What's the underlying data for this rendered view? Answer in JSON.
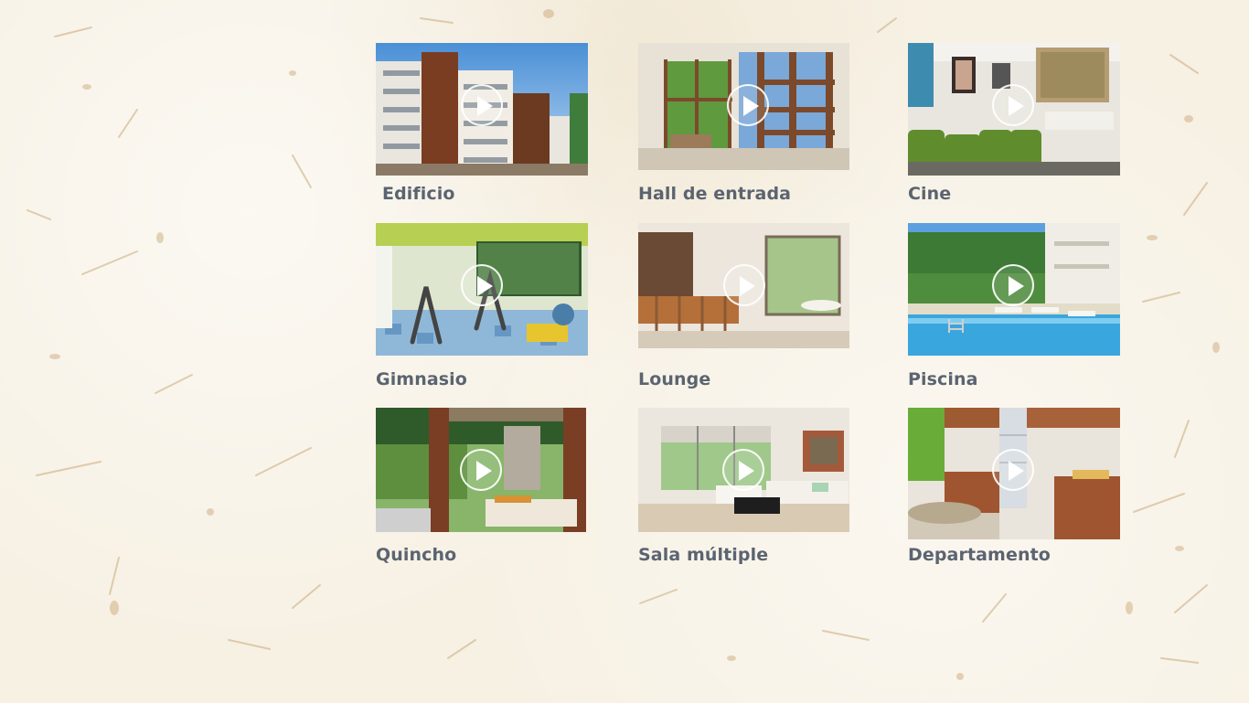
{
  "gallery": {
    "items": [
      {
        "label": "Edificio",
        "icon": "play-icon"
      },
      {
        "label": "Hall de entrada",
        "icon": "play-icon"
      },
      {
        "label": "Cine",
        "icon": "play-icon"
      },
      {
        "label": "Gimnasio",
        "icon": "play-icon"
      },
      {
        "label": "Lounge",
        "icon": "play-icon"
      },
      {
        "label": "Piscina",
        "icon": "play-icon"
      },
      {
        "label": "Quincho",
        "icon": "play-icon"
      },
      {
        "label": "Sala múltiple",
        "icon": "play-icon"
      },
      {
        "label": "Departamento",
        "icon": "play-icon"
      }
    ]
  },
  "colors": {
    "background": "#f7f1e4",
    "caption": "#5b6470",
    "play_icon": "#ffffff"
  }
}
